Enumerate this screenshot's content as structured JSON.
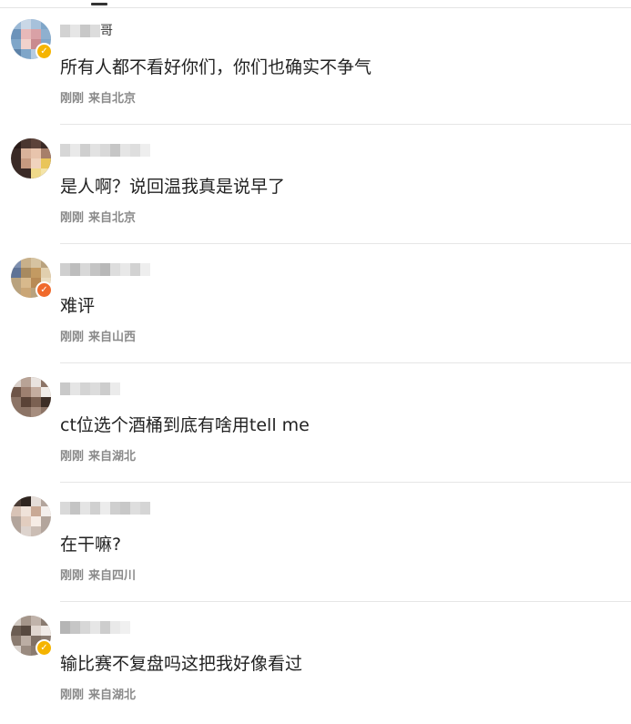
{
  "colors": {
    "verified_badge": "#f5b400",
    "verified_badge_orange": "#f06a2c",
    "meta_text": "#8a8a8a",
    "divider": "#e6e6e6"
  },
  "comments": [
    {
      "username_visible_suffix": "哥",
      "content": "所有人都不看好你们，你们也确实不争气",
      "time": "刚刚",
      "location": "来自北京",
      "verified": true
    },
    {
      "username_visible_suffix": "",
      "content": "是人啊？说回温我真是说早了",
      "time": "刚刚",
      "location": "来自北京",
      "verified": false
    },
    {
      "username_visible_suffix": "",
      "content": "难评",
      "time": "刚刚",
      "location": "来自山西",
      "verified": true
    },
    {
      "username_visible_suffix": "",
      "content": "ct位选个酒桶到底有啥用tell me",
      "time": "刚刚",
      "location": "来自湖北",
      "verified": false
    },
    {
      "username_visible_suffix": "",
      "content": "在干嘛?",
      "time": "刚刚",
      "location": "来自四川",
      "verified": false
    },
    {
      "username_visible_suffix": "",
      "content": "输比赛不复盘吗这把我好像看过",
      "time": "刚刚",
      "location": "来自湖北",
      "verified": true
    }
  ]
}
